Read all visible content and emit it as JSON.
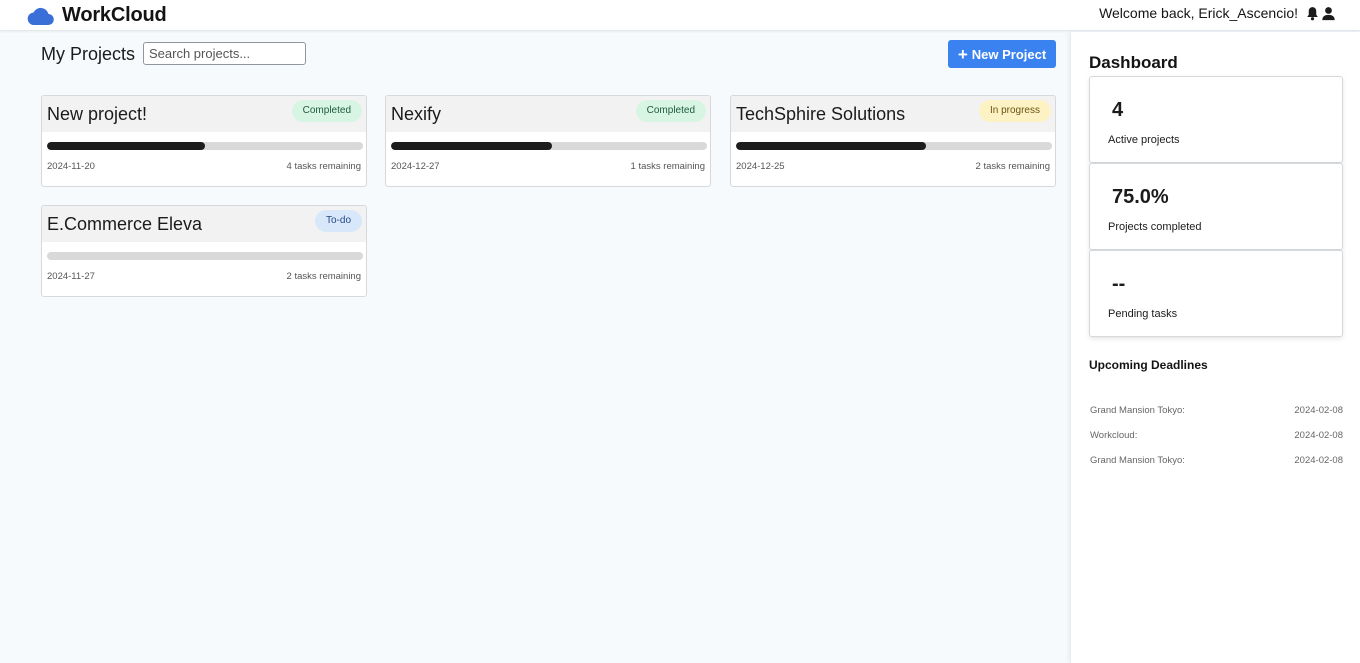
{
  "header": {
    "app_name": "WorkCloud",
    "welcome": "Welcome back, Erick_Ascencio!",
    "brand_color": "#3a6fd8",
    "icons": [
      "cloud-logo-icon",
      "bell-icon",
      "user-icon"
    ]
  },
  "projects_panel": {
    "title": "My Projects",
    "search_placeholder": "Search projects...",
    "new_button_label": "New Project",
    "new_button_color": "#3a82f0"
  },
  "projects": [
    {
      "name": "New project!",
      "status": "Completed",
      "status_type": "completed",
      "progress": 0.5,
      "date": "2024-11-20",
      "remaining": "4 tasks remaining"
    },
    {
      "name": "Nexify",
      "status": "Completed",
      "status_type": "completed",
      "progress": 0.51,
      "date": "2024-12-27",
      "remaining": "1 tasks remaining"
    },
    {
      "name": "TechSphire Solutions",
      "status": "In progress",
      "status_type": "progress",
      "progress": 0.6,
      "date": "2024-12-25",
      "remaining": "2 tasks remaining"
    },
    {
      "name": "E.Commerce Eleva",
      "status": "To-do",
      "status_type": "todo",
      "progress": 0,
      "date": "2024-11-27",
      "remaining": "2 tasks remaining"
    }
  ],
  "dashboard": {
    "title": "Dashboard",
    "stats": [
      {
        "value": "4",
        "label": "Active projects"
      },
      {
        "value": "75.0%",
        "label": "Projects completed"
      },
      {
        "value": "--",
        "label": "Pending tasks"
      }
    ],
    "upcoming_title": "Upcoming Deadlines",
    "deadlines": [
      {
        "name": "Grand Mansion Tokyo:",
        "date": "2024-02-08"
      },
      {
        "name": "Workcloud:",
        "date": "2024-02-08"
      },
      {
        "name": "Grand Mansion Tokyo:",
        "date": "2024-02-08"
      }
    ]
  }
}
